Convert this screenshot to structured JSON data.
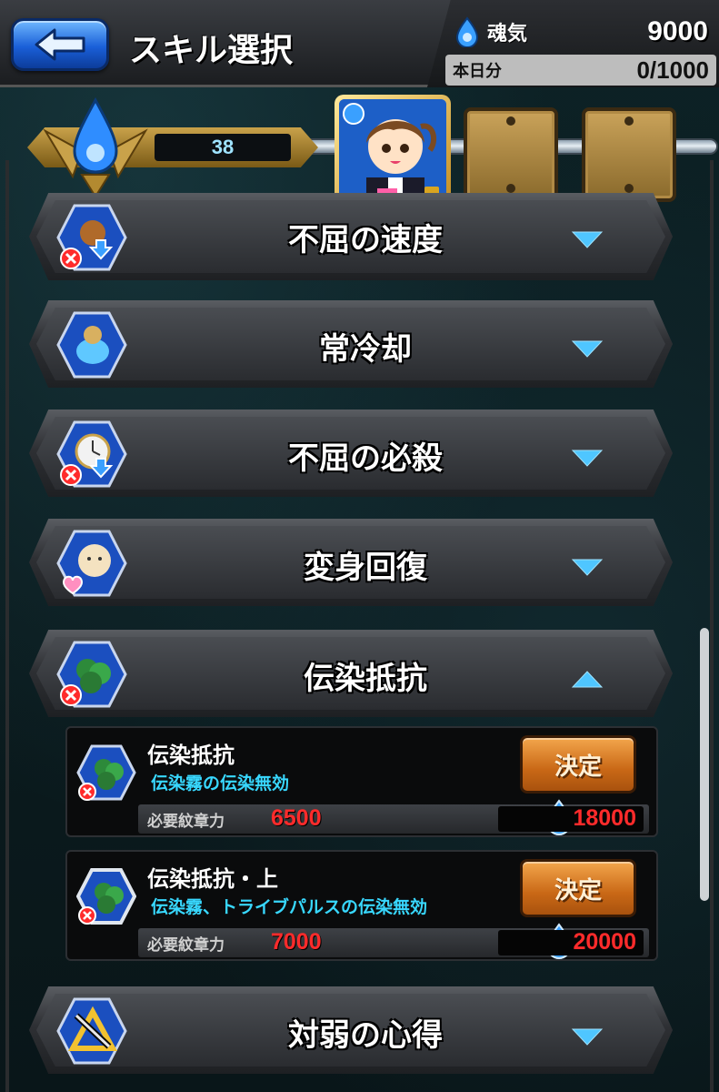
{
  "header": {
    "title": "スキル選択",
    "currency_label": "魂気",
    "currency_value": "9000",
    "today_label": "本日分",
    "today_value": "0/1000"
  },
  "rank": {
    "value": "38"
  },
  "skills": [
    {
      "name": "不屈の速度",
      "expanded": false
    },
    {
      "name": "常冷却",
      "expanded": false
    },
    {
      "name": "不屈の必殺",
      "expanded": false
    },
    {
      "name": "変身回復",
      "expanded": false
    },
    {
      "name": "伝染抵抗",
      "expanded": true
    },
    {
      "name": "対弱の心得",
      "expanded": false
    }
  ],
  "options": [
    {
      "name": "伝染抵抗",
      "desc": "伝染霧の伝染無効",
      "req_label": "必要紋章力",
      "req_value": "6500",
      "cost": "18000",
      "button": "決定"
    },
    {
      "name": "伝染抵抗・上",
      "desc": "伝染霧、トライブパルスの伝染無効",
      "req_label": "必要紋章力",
      "req_value": "7000",
      "cost": "20000",
      "button": "決定"
    }
  ],
  "colors": {
    "accent_blue": "#1a5fd8",
    "cost_red": "#ff2b2b",
    "desc_cyan": "#38d8ff",
    "button_orange": "#c96816"
  }
}
